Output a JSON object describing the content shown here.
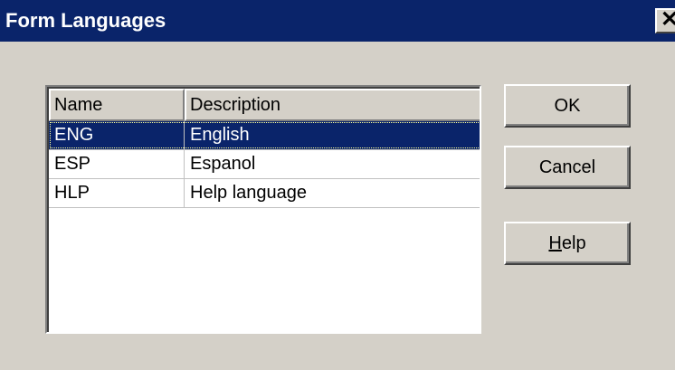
{
  "window": {
    "title": "Form Languages",
    "close_glyph": "✕"
  },
  "list": {
    "columns": [
      "Name",
      "Description"
    ],
    "rows": [
      {
        "name": "ENG",
        "description": "English",
        "selected": true
      },
      {
        "name": "ESP",
        "description": "Espanol",
        "selected": false
      },
      {
        "name": "HLP",
        "description": "Help language",
        "selected": false
      }
    ]
  },
  "buttons": {
    "ok_label": "OK",
    "cancel_label": "Cancel",
    "help_mnemonic": "H",
    "help_rest": "elp"
  },
  "colors": {
    "titlebar": "#0a246a",
    "selection": "#0a246a",
    "face": "#d4d0c8"
  }
}
